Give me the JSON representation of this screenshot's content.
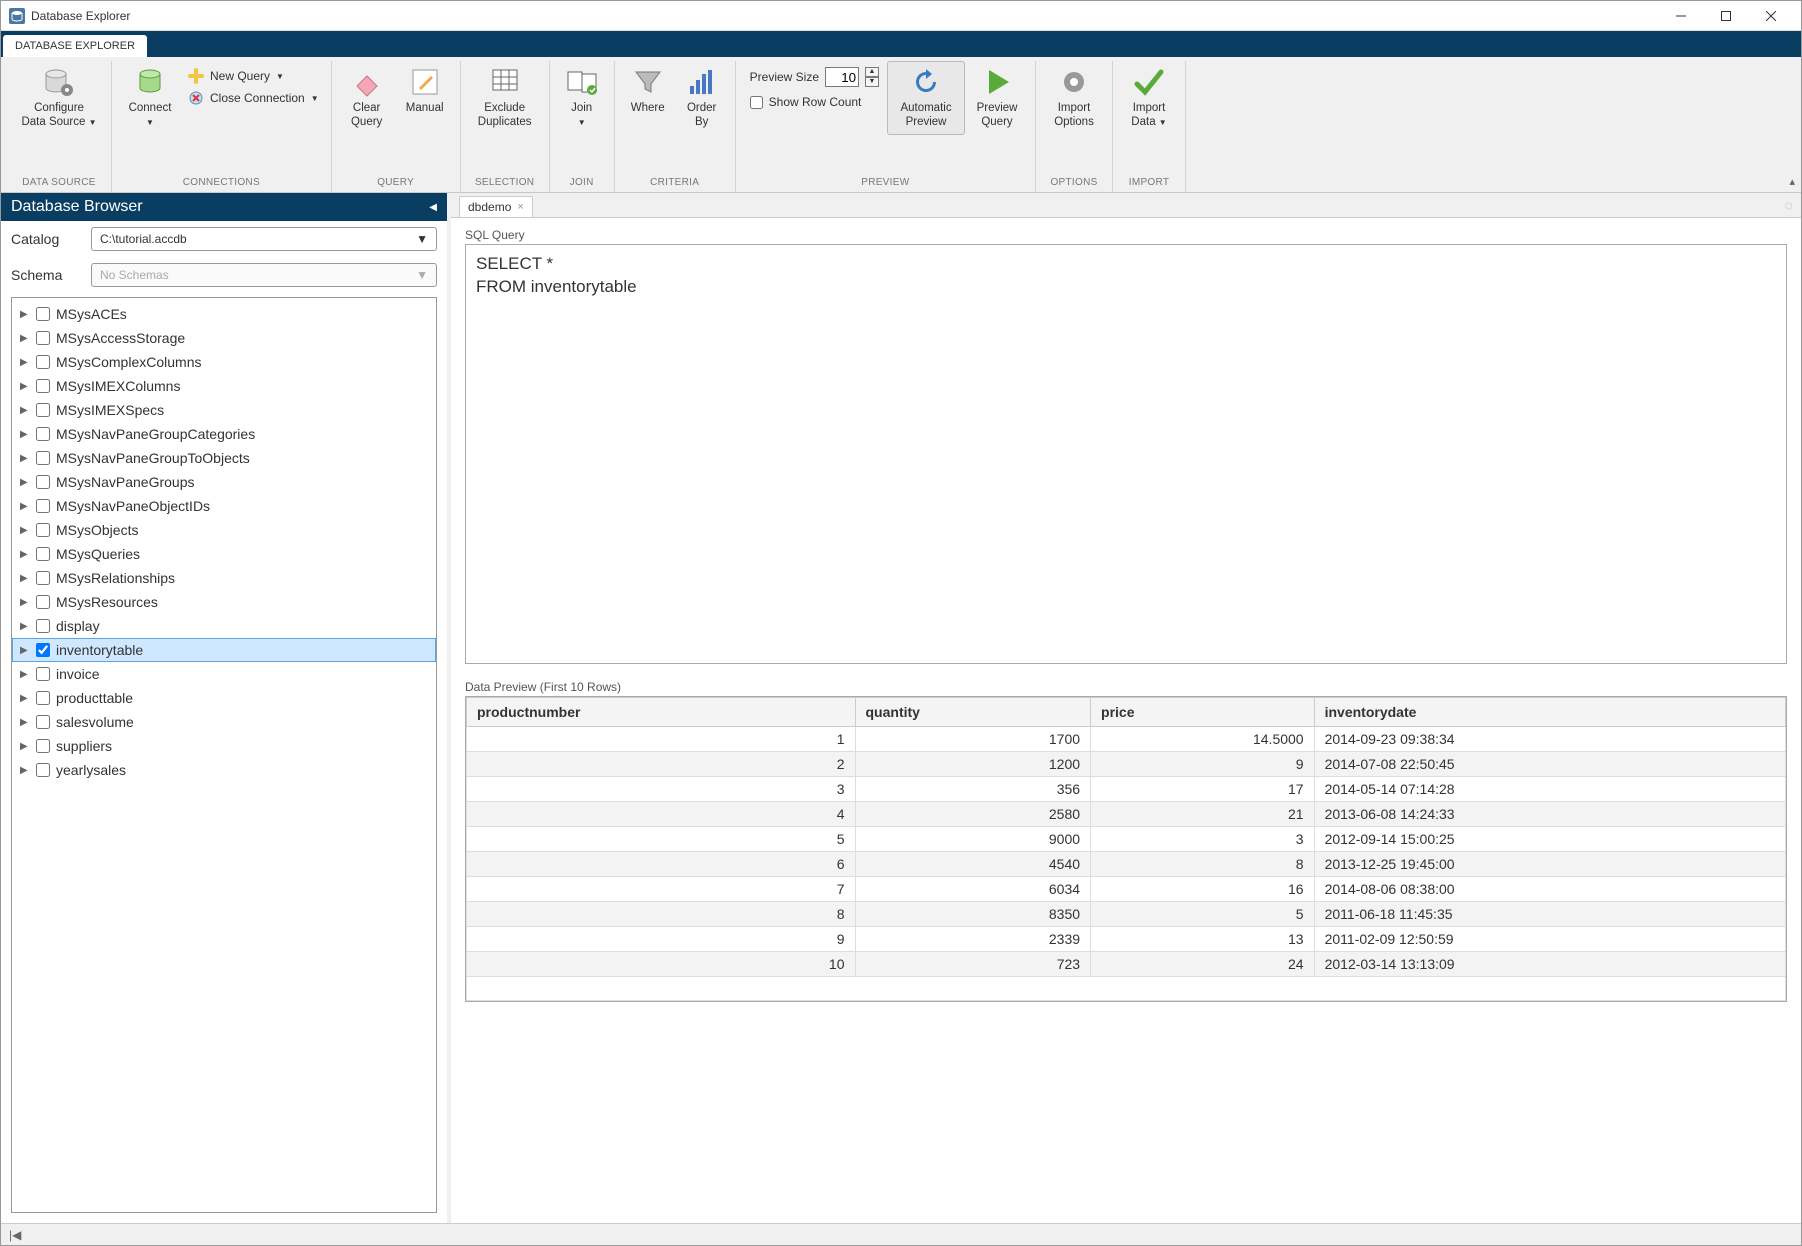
{
  "window": {
    "title": "Database Explorer"
  },
  "tabs": {
    "main": "DATABASE EXPLORER"
  },
  "ribbon": {
    "data_source": {
      "configure_l1": "Configure",
      "configure_l2": "Data Source",
      "label": "DATA SOURCE"
    },
    "connections": {
      "connect": "Connect",
      "new_query": "New Query",
      "close_conn": "Close Connection",
      "label": "CONNECTIONS"
    },
    "query": {
      "clear_l1": "Clear",
      "clear_l2": "Query",
      "manual": "Manual",
      "label": "QUERY"
    },
    "selection": {
      "exclude_l1": "Exclude",
      "exclude_l2": "Duplicates",
      "label": "SELECTION"
    },
    "join": {
      "join": "Join",
      "label": "JOIN"
    },
    "criteria": {
      "where": "Where",
      "order_l1": "Order",
      "order_l2": "By",
      "label": "CRITERIA"
    },
    "preview": {
      "size_label": "Preview Size",
      "size_value": "10",
      "show_row_count": "Show Row Count",
      "auto_l1": "Automatic",
      "auto_l2": "Preview",
      "pq_l1": "Preview",
      "pq_l2": "Query",
      "label": "PREVIEW"
    },
    "options": {
      "io_l1": "Import",
      "io_l2": "Options",
      "label": "OPTIONS"
    },
    "import": {
      "id_l1": "Import",
      "id_l2": "Data",
      "label": "IMPORT"
    }
  },
  "sidebar": {
    "title": "Database Browser",
    "catalog_label": "Catalog",
    "catalog_value": "C:\\tutorial.accdb",
    "schema_label": "Schema",
    "schema_placeholder": "No Schemas",
    "tables": [
      {
        "name": "MSysACEs",
        "checked": false,
        "selected": false
      },
      {
        "name": "MSysAccessStorage",
        "checked": false,
        "selected": false
      },
      {
        "name": "MSysComplexColumns",
        "checked": false,
        "selected": false
      },
      {
        "name": "MSysIMEXColumns",
        "checked": false,
        "selected": false
      },
      {
        "name": "MSysIMEXSpecs",
        "checked": false,
        "selected": false
      },
      {
        "name": "MSysNavPaneGroupCategories",
        "checked": false,
        "selected": false
      },
      {
        "name": "MSysNavPaneGroupToObjects",
        "checked": false,
        "selected": false
      },
      {
        "name": "MSysNavPaneGroups",
        "checked": false,
        "selected": false
      },
      {
        "name": "MSysNavPaneObjectIDs",
        "checked": false,
        "selected": false
      },
      {
        "name": "MSysObjects",
        "checked": false,
        "selected": false
      },
      {
        "name": "MSysQueries",
        "checked": false,
        "selected": false
      },
      {
        "name": "MSysRelationships",
        "checked": false,
        "selected": false
      },
      {
        "name": "MSysResources",
        "checked": false,
        "selected": false
      },
      {
        "name": "display",
        "checked": false,
        "selected": false
      },
      {
        "name": "inventorytable",
        "checked": true,
        "selected": true
      },
      {
        "name": "invoice",
        "checked": false,
        "selected": false
      },
      {
        "name": "producttable",
        "checked": false,
        "selected": false
      },
      {
        "name": "salesvolume",
        "checked": false,
        "selected": false
      },
      {
        "name": "suppliers",
        "checked": false,
        "selected": false
      },
      {
        "name": "yearlysales",
        "checked": false,
        "selected": false
      }
    ]
  },
  "doc": {
    "tab_name": "dbdemo"
  },
  "sql": {
    "label": "SQL Query",
    "text": "SELECT *\nFROM inventorytable"
  },
  "preview_data": {
    "label": "Data Preview (First 10 Rows)",
    "columns": [
      "productnumber",
      "quantity",
      "price",
      "inventorydate"
    ],
    "rows": [
      [
        "1",
        "1700",
        "14.5000",
        "2014-09-23 09:38:34"
      ],
      [
        "2",
        "1200",
        "9",
        "2014-07-08 22:50:45"
      ],
      [
        "3",
        "356",
        "17",
        "2014-05-14 07:14:28"
      ],
      [
        "4",
        "2580",
        "21",
        "2013-06-08 14:24:33"
      ],
      [
        "5",
        "9000",
        "3",
        "2012-09-14 15:00:25"
      ],
      [
        "6",
        "4540",
        "8",
        "2013-12-25 19:45:00"
      ],
      [
        "7",
        "6034",
        "16",
        "2014-08-06 08:38:00"
      ],
      [
        "8",
        "8350",
        "5",
        "2011-06-18 11:45:35"
      ],
      [
        "9",
        "2339",
        "13",
        "2011-02-09 12:50:59"
      ],
      [
        "10",
        "723",
        "24",
        "2012-03-14 13:13:09"
      ]
    ]
  }
}
